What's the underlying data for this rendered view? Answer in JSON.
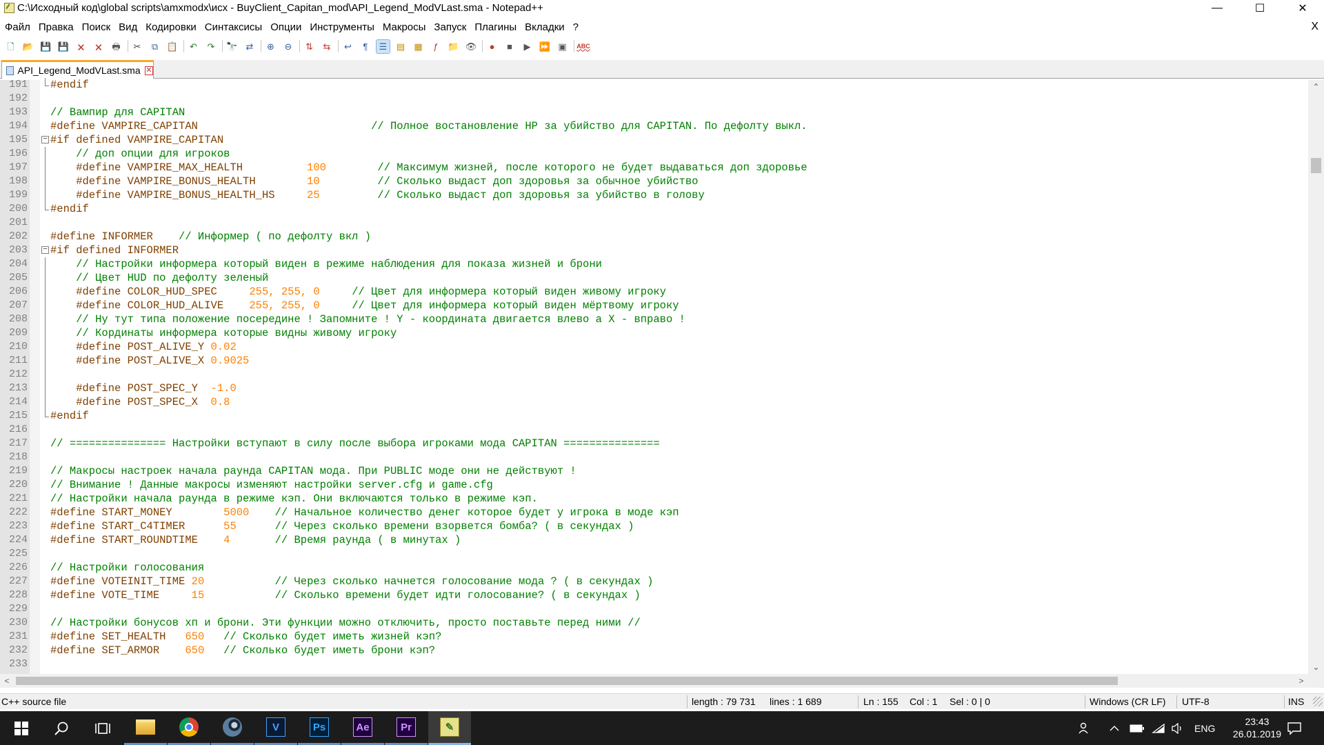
{
  "window": {
    "title": "C:\\Исходный код\\global scripts\\amxmodx\\исх - BuyClient_Capitan_mod\\API_Legend_ModVLast.sma - Notepad++",
    "minimize_glyph": "—",
    "maximize_glyph": "☐",
    "close_glyph": "✕"
  },
  "menu": {
    "items": [
      "Файл",
      "Правка",
      "Поиск",
      "Вид",
      "Кодировки",
      "Синтаксисы",
      "Опции",
      "Инструменты",
      "Макросы",
      "Запуск",
      "Плагины",
      "Вкладки",
      "?"
    ],
    "close_glyph": "X"
  },
  "toolbar": {
    "icons": [
      {
        "name": "new-file-icon",
        "glyph": "🗋",
        "color": "#2e7d32"
      },
      {
        "name": "open-file-icon",
        "glyph": "📂",
        "color": "#c48a00"
      },
      {
        "name": "save-icon",
        "glyph": "💾",
        "color": "#3a5fa0"
      },
      {
        "name": "save-all-icon",
        "glyph": "💾",
        "color": "#3a5fa0"
      },
      {
        "name": "close-file-icon",
        "glyph": "🗙",
        "color": "#c0392b"
      },
      {
        "name": "close-all-icon",
        "glyph": "🗙",
        "color": "#c0392b"
      },
      {
        "name": "print-icon",
        "glyph": "🖶",
        "color": "#555555"
      },
      {
        "name": "sep",
        "glyph": ""
      },
      {
        "name": "cut-icon",
        "glyph": "✂",
        "color": "#444444"
      },
      {
        "name": "copy-icon",
        "glyph": "⧉",
        "color": "#3a5fa0"
      },
      {
        "name": "paste-icon",
        "glyph": "📋",
        "color": "#8a6a30"
      },
      {
        "name": "sep",
        "glyph": ""
      },
      {
        "name": "undo-icon",
        "glyph": "↶",
        "color": "#2e7d32"
      },
      {
        "name": "redo-icon",
        "glyph": "↷",
        "color": "#2e7d32"
      },
      {
        "name": "sep",
        "glyph": ""
      },
      {
        "name": "find-icon",
        "glyph": "🔭",
        "color": "#333333"
      },
      {
        "name": "replace-icon",
        "glyph": "⇄",
        "color": "#3a5fa0"
      },
      {
        "name": "sep",
        "glyph": ""
      },
      {
        "name": "zoom-in-icon",
        "glyph": "⊕",
        "color": "#3a5fa0"
      },
      {
        "name": "zoom-out-icon",
        "glyph": "⊖",
        "color": "#3a5fa0"
      },
      {
        "name": "sep",
        "glyph": ""
      },
      {
        "name": "sync-vertical-icon",
        "glyph": "⇅",
        "color": "#c0392b"
      },
      {
        "name": "sync-horizontal-icon",
        "glyph": "⇆",
        "color": "#c0392b"
      },
      {
        "name": "sep",
        "glyph": ""
      },
      {
        "name": "word-wrap-icon",
        "glyph": "↩",
        "color": "#3a5fa0"
      },
      {
        "name": "show-all-chars-icon",
        "glyph": "¶",
        "color": "#3a5fa0"
      },
      {
        "name": "indent-guide-icon",
        "glyph": "☰",
        "color": "#3a5fa0",
        "active": true
      },
      {
        "name": "language-udl-icon",
        "glyph": "▤",
        "color": "#c48a00"
      },
      {
        "name": "doc-map-icon",
        "glyph": "▦",
        "color": "#c48a00"
      },
      {
        "name": "function-list-icon",
        "glyph": "ƒ",
        "color": "#c0392b"
      },
      {
        "name": "folder-workspace-icon",
        "glyph": "📁",
        "color": "#c0392b"
      },
      {
        "name": "monitoring-icon",
        "glyph": "👁",
        "color": "#555555"
      },
      {
        "name": "sep",
        "glyph": ""
      },
      {
        "name": "record-macro-icon",
        "glyph": "●",
        "color": "#c0392b"
      },
      {
        "name": "stop-macro-icon",
        "glyph": "■",
        "color": "#555555"
      },
      {
        "name": "play-macro-icon",
        "glyph": "▶",
        "color": "#555555"
      },
      {
        "name": "run-macro-multiple-icon",
        "glyph": "⏩",
        "color": "#3a5fa0"
      },
      {
        "name": "save-macro-icon",
        "glyph": "▣",
        "color": "#555555"
      },
      {
        "name": "sep",
        "glyph": ""
      },
      {
        "name": "spell-check-icon",
        "glyph": "ABC",
        "color": "#c0392b"
      }
    ]
  },
  "tab": {
    "label": "API_Legend_ModVLast.sma",
    "close_glyph": "✕"
  },
  "editor": {
    "lines": [
      {
        "n": "191",
        "fold": "end",
        "segs": [
          {
            "c": "pp",
            "t": "#endif"
          }
        ]
      },
      {
        "n": "192",
        "segs": []
      },
      {
        "n": "193",
        "segs": [
          {
            "c": "cm",
            "t": "// Вампир для CAPITAN"
          }
        ]
      },
      {
        "n": "194",
        "segs": [
          {
            "c": "pp",
            "t": "#define VAMPIRE_CAPITAN                           "
          },
          {
            "c": "cm",
            "t": "// Полное востановление HP за убийство для CAPITAN. По дефолту выкл."
          }
        ]
      },
      {
        "n": "195",
        "fold": "open",
        "segs": [
          {
            "c": "pp",
            "t": "#if defined VAMPIRE_CAPITAN"
          }
        ]
      },
      {
        "n": "196",
        "fold": "bar",
        "segs": [
          {
            "c": "cm",
            "t": "    // доп опции для игроков"
          }
        ]
      },
      {
        "n": "197",
        "fold": "bar",
        "segs": [
          {
            "c": "pp",
            "t": "    #define VAMPIRE_MAX_HEALTH          "
          },
          {
            "c": "nm",
            "t": "100"
          },
          {
            "c": "pp",
            "t": "        "
          },
          {
            "c": "cm",
            "t": "// Максимум жизней, после которого не будет выдаваться доп здоровье"
          }
        ]
      },
      {
        "n": "198",
        "fold": "bar",
        "segs": [
          {
            "c": "pp",
            "t": "    #define VAMPIRE_BONUS_HEALTH        "
          },
          {
            "c": "nm",
            "t": "10"
          },
          {
            "c": "pp",
            "t": "         "
          },
          {
            "c": "cm",
            "t": "// Сколько выдаст доп здоровья за обычное убийство"
          }
        ]
      },
      {
        "n": "199",
        "fold": "bar",
        "segs": [
          {
            "c": "pp",
            "t": "    #define VAMPIRE_BONUS_HEALTH_HS     "
          },
          {
            "c": "nm",
            "t": "25"
          },
          {
            "c": "pp",
            "t": "         "
          },
          {
            "c": "cm",
            "t": "// Сколько выдаст доп здоровья за убийство в голову"
          }
        ]
      },
      {
        "n": "200",
        "fold": "end",
        "segs": [
          {
            "c": "pp",
            "t": "#endif"
          }
        ]
      },
      {
        "n": "201",
        "segs": []
      },
      {
        "n": "202",
        "segs": [
          {
            "c": "pp",
            "t": "#define INFORMER    "
          },
          {
            "c": "cm",
            "t": "// Информер ( по дефолту вкл )"
          }
        ]
      },
      {
        "n": "203",
        "fold": "open",
        "segs": [
          {
            "c": "pp",
            "t": "#if defined INFORMER"
          }
        ]
      },
      {
        "n": "204",
        "fold": "bar",
        "segs": [
          {
            "c": "cm",
            "t": "    // Настройки информера который виден в режиме наблюдения для показа жизней и брони"
          }
        ]
      },
      {
        "n": "205",
        "fold": "bar",
        "segs": [
          {
            "c": "cm",
            "t": "    // Цвет HUD по дефолту зеленый"
          }
        ]
      },
      {
        "n": "206",
        "fold": "bar",
        "segs": [
          {
            "c": "pp",
            "t": "    #define COLOR_HUD_SPEC     "
          },
          {
            "c": "nm",
            "t": "255, 255, 0"
          },
          {
            "c": "pp",
            "t": "     "
          },
          {
            "c": "cm",
            "t": "// Цвет для информера который виден живому игроку"
          }
        ]
      },
      {
        "n": "207",
        "fold": "bar",
        "segs": [
          {
            "c": "pp",
            "t": "    #define COLOR_HUD_ALIVE    "
          },
          {
            "c": "nm",
            "t": "255, 255, 0"
          },
          {
            "c": "pp",
            "t": "     "
          },
          {
            "c": "cm",
            "t": "// Цвет для информера который виден мёртвому игроку"
          }
        ]
      },
      {
        "n": "208",
        "fold": "bar",
        "segs": [
          {
            "c": "cm",
            "t": "    // Ну тут типа положение посередине ! Запомните ! Y - координата двигается влево а X - вправо !"
          }
        ]
      },
      {
        "n": "209",
        "fold": "bar",
        "segs": [
          {
            "c": "cm",
            "t": "    // Кординаты информера которые видны живому игроку"
          }
        ]
      },
      {
        "n": "210",
        "fold": "bar",
        "segs": [
          {
            "c": "pp",
            "t": "    #define POST_ALIVE_Y "
          },
          {
            "c": "nm",
            "t": "0.02"
          }
        ]
      },
      {
        "n": "211",
        "fold": "bar",
        "segs": [
          {
            "c": "pp",
            "t": "    #define POST_ALIVE_X "
          },
          {
            "c": "nm",
            "t": "0.9025"
          }
        ]
      },
      {
        "n": "212",
        "fold": "bar",
        "segs": []
      },
      {
        "n": "213",
        "fold": "bar",
        "segs": [
          {
            "c": "pp",
            "t": "    #define POST_SPEC_Y  "
          },
          {
            "c": "nm",
            "t": "-1.0"
          }
        ]
      },
      {
        "n": "214",
        "fold": "bar",
        "segs": [
          {
            "c": "pp",
            "t": "    #define POST_SPEC_X  "
          },
          {
            "c": "nm",
            "t": "0.8"
          }
        ]
      },
      {
        "n": "215",
        "fold": "end",
        "segs": [
          {
            "c": "pp",
            "t": "#endif"
          }
        ]
      },
      {
        "n": "216",
        "segs": []
      },
      {
        "n": "217",
        "segs": [
          {
            "c": "cm",
            "t": "// =============== Настройки вступают в силу после выбора игроками мода CAPITAN ==============="
          }
        ]
      },
      {
        "n": "218",
        "segs": []
      },
      {
        "n": "219",
        "segs": [
          {
            "c": "cm",
            "t": "// Макросы настроек начала раунда CAPITAN мода. При PUBLIC моде они не действуют !"
          }
        ]
      },
      {
        "n": "220",
        "segs": [
          {
            "c": "cm",
            "t": "// Внимание ! Данные макросы изменяют настройки server.cfg и game.cfg"
          }
        ]
      },
      {
        "n": "221",
        "segs": [
          {
            "c": "cm",
            "t": "// Настройки начала раунда в режиме кэп. Они включаются только в режиме кэп."
          }
        ]
      },
      {
        "n": "222",
        "segs": [
          {
            "c": "pp",
            "t": "#define START_MONEY        "
          },
          {
            "c": "nm",
            "t": "5000"
          },
          {
            "c": "pp",
            "t": "    "
          },
          {
            "c": "cm",
            "t": "// Начальное количество денег которое будет у игрока в моде кэп"
          }
        ]
      },
      {
        "n": "223",
        "segs": [
          {
            "c": "pp",
            "t": "#define START_C4TIMER      "
          },
          {
            "c": "nm",
            "t": "55"
          },
          {
            "c": "pp",
            "t": "      "
          },
          {
            "c": "cm",
            "t": "// Через сколько времени взорвется бомба? ( в секундах )"
          }
        ]
      },
      {
        "n": "224",
        "segs": [
          {
            "c": "pp",
            "t": "#define START_ROUNDTIME    "
          },
          {
            "c": "nm",
            "t": "4"
          },
          {
            "c": "pp",
            "t": "       "
          },
          {
            "c": "cm",
            "t": "// Время раунда ( в минутах )"
          }
        ]
      },
      {
        "n": "225",
        "segs": []
      },
      {
        "n": "226",
        "segs": [
          {
            "c": "cm",
            "t": "// Настройки голосования"
          }
        ]
      },
      {
        "n": "227",
        "segs": [
          {
            "c": "pp",
            "t": "#define VOTEINIT_TIME "
          },
          {
            "c": "nm",
            "t": "20"
          },
          {
            "c": "pp",
            "t": "           "
          },
          {
            "c": "cm",
            "t": "// Через сколько начнется голосование мода ? ( в секундах )"
          }
        ]
      },
      {
        "n": "228",
        "segs": [
          {
            "c": "pp",
            "t": "#define VOTE_TIME     "
          },
          {
            "c": "nm",
            "t": "15"
          },
          {
            "c": "pp",
            "t": "           "
          },
          {
            "c": "cm",
            "t": "// Сколько времени будет идти голосование? ( в секундах )"
          }
        ]
      },
      {
        "n": "229",
        "segs": []
      },
      {
        "n": "230",
        "segs": [
          {
            "c": "cm",
            "t": "// Настройки бонусов хп и брони. Эти функции можно отключить, просто поставьте перед ними //"
          }
        ]
      },
      {
        "n": "231",
        "segs": [
          {
            "c": "pp",
            "t": "#define SET_HEALTH   "
          },
          {
            "c": "nm",
            "t": "650"
          },
          {
            "c": "pp",
            "t": "   "
          },
          {
            "c": "cm",
            "t": "// Сколько будет иметь жизней кэп?"
          }
        ]
      },
      {
        "n": "232",
        "segs": [
          {
            "c": "pp",
            "t": "#define SET_ARMOR    "
          },
          {
            "c": "nm",
            "t": "650"
          },
          {
            "c": "pp",
            "t": "   "
          },
          {
            "c": "cm",
            "t": "// Сколько будет иметь брони кэп?"
          }
        ]
      },
      {
        "n": "233",
        "segs": []
      }
    ],
    "colors": {
      "preprocessor": "#804000",
      "comment": "#008000",
      "number": "#FF8000"
    }
  },
  "scrollbars": {
    "up_glyph": "⌃",
    "down_glyph": "⌄",
    "left_glyph": "<",
    "right_glyph": ">"
  },
  "status": {
    "file_type": "C++ source file",
    "length": "length : 79 731",
    "lines": "lines : 1 689",
    "ln": "Ln : 155",
    "col": "Col : 1",
    "sel": "Sel : 0 | 0",
    "eol": "Windows (CR LF)",
    "encoding": "UTF-8",
    "mode": "INS"
  },
  "taskbar": {
    "language": "ENG",
    "time": "23:43",
    "date": "26.01.2019",
    "apps": [
      {
        "name": "file-explorer-icon",
        "label": "",
        "bg": "#f2c14e",
        "fg": "#f2c14e"
      },
      {
        "name": "chrome-icon",
        "label": "",
        "bg": "chrome",
        "fg": "#fff"
      },
      {
        "name": "steam-icon",
        "label": "",
        "bg": "steam",
        "fg": "#fff"
      },
      {
        "name": "vegas-icon",
        "label": "V",
        "bg": "#0a1a33",
        "fg": "#4aa0ff"
      },
      {
        "name": "photoshop-icon",
        "label": "Ps",
        "bg": "#001e36",
        "fg": "#31a8ff"
      },
      {
        "name": "after-effects-icon",
        "label": "Ae",
        "bg": "#1f0040",
        "fg": "#cf96fd"
      },
      {
        "name": "premiere-icon",
        "label": "Pr",
        "bg": "#1f0040",
        "fg": "#d291ff"
      },
      {
        "name": "notepadpp-icon",
        "label": "",
        "bg": "npp",
        "fg": "#fff",
        "active": true
      }
    ]
  }
}
